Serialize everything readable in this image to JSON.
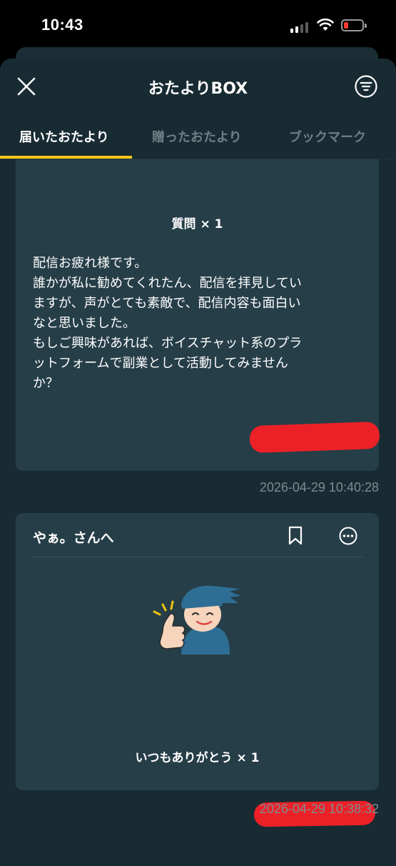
{
  "status_bar": {
    "time": "10:43"
  },
  "header": {
    "title": "おたよりBOX",
    "close_icon": "close-icon",
    "filter_icon": "filter-icon"
  },
  "tabs": [
    {
      "label": "届いたおたより",
      "active": true
    },
    {
      "label": "贈ったおたより",
      "active": false
    },
    {
      "label": "ブックマーク",
      "active": false
    }
  ],
  "letters": [
    {
      "gift_label": "質問 × 1",
      "message_lines": [
        "配信お疲れ様です。",
        "誰かが私に勧めてくれたん、配信を拝見してい",
        "ますが、声がとても素敵で、配信内容も面白い",
        "なと思いました。",
        "もしご興味があれば、ボイスチャット系のプラ",
        "ットフォームで副業として活動してみません",
        "か？"
      ],
      "sender_redacted": true,
      "timestamp": "2026-04-29 10:40:28"
    },
    {
      "recipient": "やぁ。さんへ",
      "bookmark_icon": "bookmark-icon",
      "more_icon": "more-icon",
      "sticker_icon": "thumbs-up-character-icon",
      "gift_label": "いつもありがとう × 1",
      "sender_redacted": true,
      "timestamp": "2026-04-29 10:38:32"
    }
  ],
  "colors": {
    "background": "#182b32",
    "card": "#263e48",
    "tab_accent": "#f5c518",
    "redaction": "#ec2127"
  }
}
